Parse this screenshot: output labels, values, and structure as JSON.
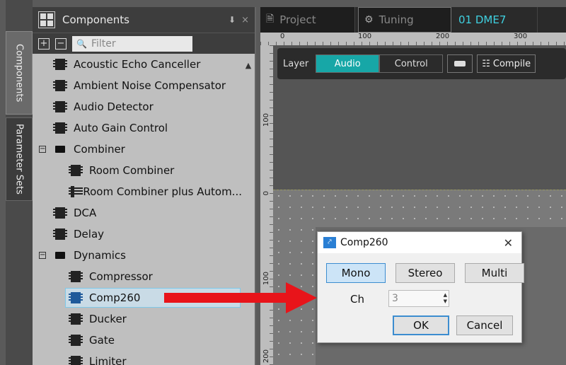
{
  "side_tabs": [
    "Components",
    "Parameter Sets"
  ],
  "panel": {
    "title": "Components",
    "pin_glyph": "📌",
    "close_glyph": "×",
    "expand_all": "+",
    "collapse_all": "−",
    "filter_placeholder": "Filter"
  },
  "tree": [
    {
      "label": "Acoustic Echo Canceller",
      "type": "component",
      "indent": 0
    },
    {
      "label": "Ambient Noise Compensator",
      "type": "component",
      "indent": 0
    },
    {
      "label": "Audio Detector",
      "type": "component",
      "indent": 0
    },
    {
      "label": "Auto Gain Control",
      "type": "component",
      "indent": 0
    },
    {
      "label": "Combiner",
      "type": "folder",
      "indent": 0,
      "expander": "−"
    },
    {
      "label": "Room Combiner",
      "type": "component",
      "indent": 1
    },
    {
      "label": "Room Combiner plus Autom...",
      "type": "component",
      "indent": 1
    },
    {
      "label": "DCA",
      "type": "component",
      "indent": 0
    },
    {
      "label": "Delay",
      "type": "component",
      "indent": 0
    },
    {
      "label": "Dynamics",
      "type": "folder",
      "indent": 0,
      "expander": "−"
    },
    {
      "label": "Compressor",
      "type": "component",
      "indent": 1
    },
    {
      "label": "Comp260",
      "type": "component",
      "indent": 1,
      "selected": true
    },
    {
      "label": "Ducker",
      "type": "component",
      "indent": 1
    },
    {
      "label": "Gate",
      "type": "component",
      "indent": 1
    },
    {
      "label": "Limiter",
      "type": "component",
      "indent": 1
    }
  ],
  "tabs": {
    "project": "Project",
    "tuning": "Tuning",
    "device": "01 DME7"
  },
  "ruler": {
    "top": [
      "0",
      "100",
      "200",
      "300"
    ],
    "left": [
      "100",
      "0",
      "100",
      "200"
    ]
  },
  "toolbar": {
    "layer_label": "Layer",
    "audio": "Audio",
    "control": "Control",
    "compile": "Compile"
  },
  "dialog": {
    "title": "Comp260",
    "close": "✕",
    "modes": [
      "Mono",
      "Stereo",
      "Multi"
    ],
    "active_mode": "Mono",
    "ch_label": "Ch",
    "ch_value": "3",
    "ok": "OK",
    "cancel": "Cancel"
  },
  "colors": {
    "accent_teal": "#17a7a7",
    "device_tab_text": "#3fd0e0",
    "arrow_red": "#e8141a",
    "selection": "#7fc8e8"
  }
}
